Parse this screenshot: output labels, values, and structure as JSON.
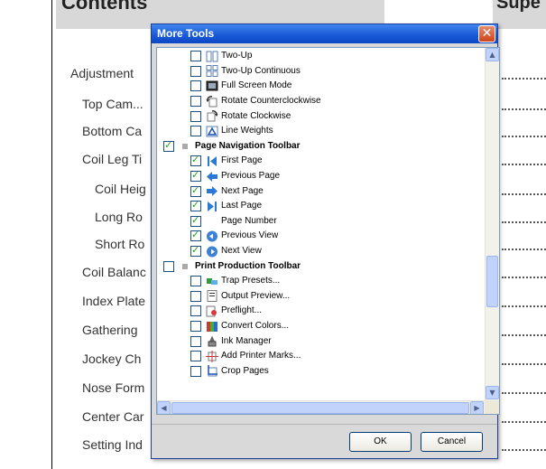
{
  "document": {
    "heading_left": "Contents",
    "heading_right": "Supe",
    "toc": [
      {
        "text": "Adjustment",
        "indent": 0
      },
      {
        "text": "Top Cam...",
        "indent": 1
      },
      {
        "text": "Bottom Ca",
        "indent": 1
      },
      {
        "text": "Coil Leg Ti",
        "indent": 1
      },
      {
        "text": "Coil Heig",
        "indent": 2
      },
      {
        "text": "Long Ro",
        "indent": 2
      },
      {
        "text": "Short Ro",
        "indent": 2
      },
      {
        "text": "Coil Balanc",
        "indent": 1
      },
      {
        "text": "Index Plate",
        "indent": 1
      },
      {
        "text": "Gathering",
        "indent": 1
      },
      {
        "text": "Jockey Ch",
        "indent": 1
      },
      {
        "text": "Nose Form",
        "indent": 1
      },
      {
        "text": "Center Car",
        "indent": 1
      },
      {
        "text": "Setting Ind",
        "indent": 1
      }
    ]
  },
  "dialog": {
    "title": "More Tools",
    "close_glyph": "✕",
    "ok_label": "OK",
    "cancel_label": "Cancel",
    "items": [
      {
        "label": "Two-Up",
        "checked": false,
        "icon": "two-up-icon",
        "group": false
      },
      {
        "label": "Two-Up Continuous",
        "checked": false,
        "icon": "two-up-continuous-icon",
        "group": false
      },
      {
        "label": "Full Screen Mode",
        "checked": false,
        "icon": "full-screen-icon",
        "group": false
      },
      {
        "label": "Rotate Counterclockwise",
        "checked": false,
        "icon": "rotate-ccw-icon",
        "group": false
      },
      {
        "label": "Rotate Clockwise",
        "checked": false,
        "icon": "rotate-cw-icon",
        "group": false
      },
      {
        "label": "Line Weights",
        "checked": false,
        "icon": "line-weights-icon",
        "group": false
      },
      {
        "label": "Page Navigation Toolbar",
        "checked": true,
        "icon": "",
        "group": true
      },
      {
        "label": "First Page",
        "checked": true,
        "icon": "first-page-icon",
        "group": false
      },
      {
        "label": "Previous Page",
        "checked": true,
        "icon": "previous-page-icon",
        "group": false
      },
      {
        "label": "Next Page",
        "checked": true,
        "icon": "next-page-icon",
        "group": false
      },
      {
        "label": "Last Page",
        "checked": true,
        "icon": "last-page-icon",
        "group": false
      },
      {
        "label": "Page Number",
        "checked": true,
        "icon": "",
        "group": false
      },
      {
        "label": "Previous View",
        "checked": true,
        "icon": "previous-view-icon",
        "group": false
      },
      {
        "label": "Next View",
        "checked": true,
        "icon": "next-view-icon",
        "group": false
      },
      {
        "label": "Print Production Toolbar",
        "checked": false,
        "icon": "",
        "group": true
      },
      {
        "label": "Trap Presets...",
        "checked": false,
        "icon": "trap-presets-icon",
        "group": false
      },
      {
        "label": "Output Preview...",
        "checked": false,
        "icon": "output-preview-icon",
        "group": false
      },
      {
        "label": "Preflight...",
        "checked": false,
        "icon": "preflight-icon",
        "group": false
      },
      {
        "label": "Convert Colors...",
        "checked": false,
        "icon": "convert-colors-icon",
        "group": false
      },
      {
        "label": "Ink Manager",
        "checked": false,
        "icon": "ink-manager-icon",
        "group": false
      },
      {
        "label": "Add Printer Marks...",
        "checked": false,
        "icon": "printer-marks-icon",
        "group": false
      },
      {
        "label": "Crop Pages",
        "checked": false,
        "icon": "crop-pages-icon",
        "group": false
      }
    ]
  },
  "colors": {
    "titlebar": "#1757d6",
    "check": "#21a121",
    "nav_arrow": "#2a78d8"
  }
}
